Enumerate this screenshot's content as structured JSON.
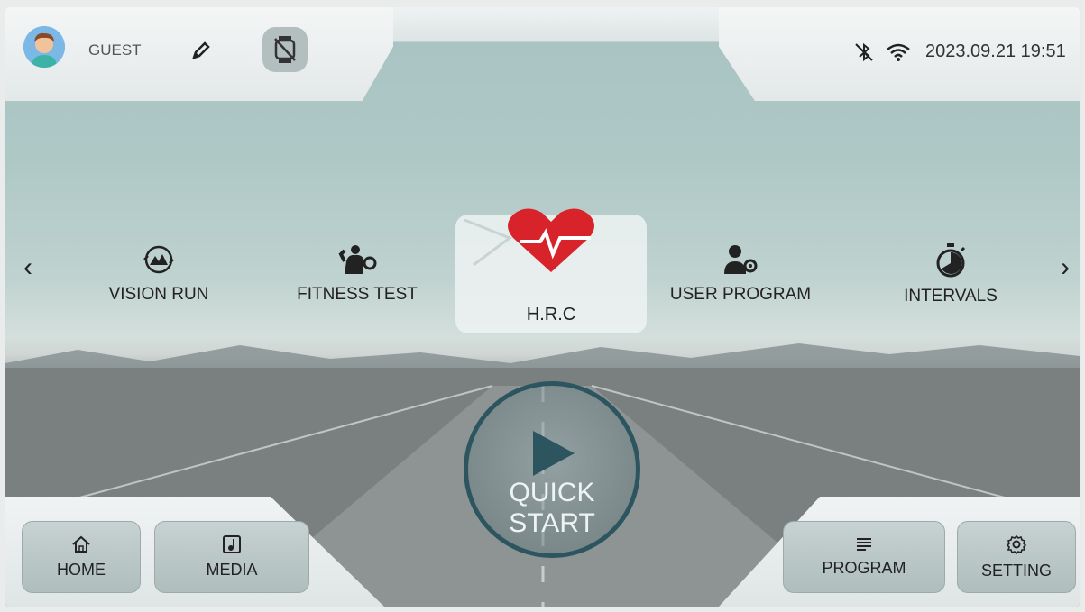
{
  "user": {
    "name": "GUEST"
  },
  "status": {
    "datetime": "2023.09.21 19:51"
  },
  "programs": [
    {
      "label": "VISION RUN",
      "icon": "vision-run-icon"
    },
    {
      "label": "FITNESS TEST",
      "icon": "fitness-test-icon"
    },
    {
      "label": "H.R.C",
      "icon": "heart-rate-icon",
      "selected": true
    },
    {
      "label": "USER PROGRAM",
      "icon": "user-program-icon"
    },
    {
      "label": "INTERVALS",
      "icon": "stopwatch-icon"
    }
  ],
  "quick_start": {
    "label": "QUICK START"
  },
  "bottom_nav": {
    "home": "HOME",
    "media": "MEDIA",
    "program": "PROGRAM",
    "setting": "SETTING"
  },
  "colors": {
    "accent": "#2d5560",
    "heart": "#d8232a"
  }
}
